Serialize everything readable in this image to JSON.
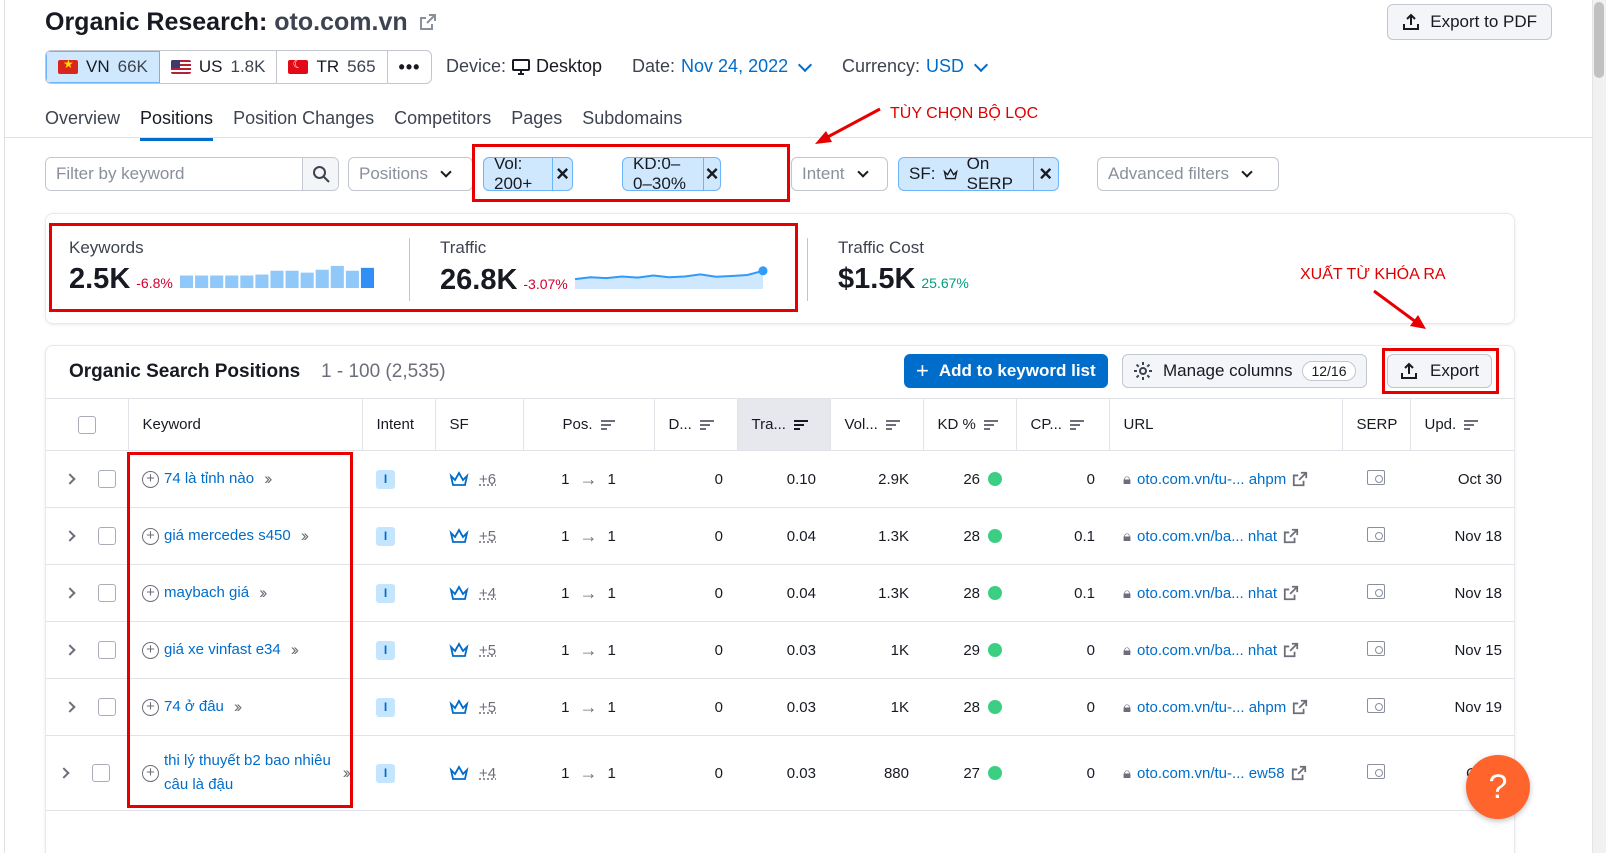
{
  "header": {
    "title_prefix": "Organic Research:",
    "domain": "oto.com.vn",
    "export_pdf_label": "Export to PDF"
  },
  "databases": [
    {
      "code": "VN",
      "count": "66K",
      "flag": "vn-flag",
      "active": true
    },
    {
      "code": "US",
      "count": "1.8K",
      "flag": "us-flag",
      "active": false
    },
    {
      "code": "TR",
      "count": "565",
      "flag": "tr-flag",
      "active": false
    }
  ],
  "meta": {
    "device_label": "Device:",
    "device_value": "Desktop",
    "date_label": "Date:",
    "date_value": "Nov 24, 2022",
    "currency_label": "Currency:",
    "currency_value": "USD"
  },
  "tabs": [
    "Overview",
    "Positions",
    "Position Changes",
    "Competitors",
    "Pages",
    "Subdomains"
  ],
  "active_tab": "Positions",
  "annotations": {
    "filter_options": "TÙY CHỌN BỘ LỌC",
    "export_keywords": "XUẤT TỪ KHÓA RA"
  },
  "filters": {
    "keyword_placeholder": "Filter by keyword",
    "positions_label": "Positions",
    "chip_vol": "Vol: 200+",
    "chip_kd": "KD:0– 0–30%",
    "intent_label": "Intent",
    "chip_sf_prefix": "SF:",
    "chip_sf_value": "On SERP",
    "advanced_label": "Advanced filters"
  },
  "summary": {
    "keywords": {
      "label": "Keywords",
      "value": "2.5K",
      "change": "-6.8%"
    },
    "traffic": {
      "label": "Traffic",
      "value": "26.8K",
      "change": "-3.07%"
    },
    "traffic_cost": {
      "label": "Traffic Cost",
      "value": "$1.5K",
      "change": "25.67%"
    },
    "keywords_bars": [
      0.52,
      0.52,
      0.52,
      0.52,
      0.52,
      0.56,
      0.72,
      0.72,
      0.64,
      0.76,
      0.92,
      0.72,
      0.84
    ],
    "traffic_trend": [
      0.62,
      0.55,
      0.58,
      0.52,
      0.56,
      0.48,
      0.55,
      0.52,
      0.44,
      0.53,
      0.5,
      0.46,
      0.3
    ]
  },
  "panel": {
    "title": "Organic Search Positions",
    "range": "1 - 100 (2,535)",
    "add_to_list_label": "Add to keyword list",
    "manage_columns_label": "Manage columns",
    "manage_columns_count": "12/16",
    "export_label": "Export"
  },
  "columns": [
    "Keyword",
    "Intent",
    "SF",
    "Pos.",
    "D...",
    "Tra...",
    "Vol...",
    "KD %",
    "CP...",
    "URL",
    "SERP",
    "Upd."
  ],
  "rows": [
    {
      "keyword": "74 là tỉnh nào",
      "intent": "I",
      "sf": "+6",
      "pos_from": "1",
      "pos_to": "1",
      "diff": "0",
      "traffic": "0.10",
      "volume": "2.9K",
      "kd": "26",
      "cpc": "0",
      "url": "oto.com.vn/tu-... ahpm",
      "updated": "Oct 30"
    },
    {
      "keyword": "giá mercedes s450",
      "intent": "I",
      "sf": "+5",
      "pos_from": "1",
      "pos_to": "1",
      "diff": "0",
      "traffic": "0.04",
      "volume": "1.3K",
      "kd": "28",
      "cpc": "0.1",
      "url": "oto.com.vn/ba... nhat",
      "updated": "Nov 18"
    },
    {
      "keyword": "maybach giá",
      "intent": "I",
      "sf": "+4",
      "pos_from": "1",
      "pos_to": "1",
      "diff": "0",
      "traffic": "0.04",
      "volume": "1.3K",
      "kd": "28",
      "cpc": "0.1",
      "url": "oto.com.vn/ba... nhat",
      "updated": "Nov 18"
    },
    {
      "keyword": "giá xe vinfast e34",
      "intent": "I",
      "sf": "+5",
      "pos_from": "1",
      "pos_to": "1",
      "diff": "0",
      "traffic": "0.03",
      "volume": "1K",
      "kd": "29",
      "cpc": "0",
      "url": "oto.com.vn/ba... nhat",
      "updated": "Nov 15"
    },
    {
      "keyword": "74 ở đâu",
      "intent": "I",
      "sf": "+5",
      "pos_from": "1",
      "pos_to": "1",
      "diff": "0",
      "traffic": "0.03",
      "volume": "1K",
      "kd": "28",
      "cpc": "0",
      "url": "oto.com.vn/tu-... ahpm",
      "updated": "Nov 19"
    },
    {
      "keyword": "thi lý thuyết b2 bao nhiêu câu là đậu",
      "intent": "I",
      "sf": "+4",
      "pos_from": "1",
      "pos_to": "1",
      "diff": "0",
      "traffic": "0.03",
      "volume": "880",
      "kd": "27",
      "cpc": "0",
      "url": "oto.com.vn/tu-... ew58",
      "updated": "Oct 2"
    }
  ],
  "help_label": "?",
  "colors": {
    "accent": "#006dca",
    "chip_bg": "#d0e8fd",
    "annotation_red": "#e80000",
    "kd_easy": "#3ccf84",
    "fab": "#ff642d"
  }
}
